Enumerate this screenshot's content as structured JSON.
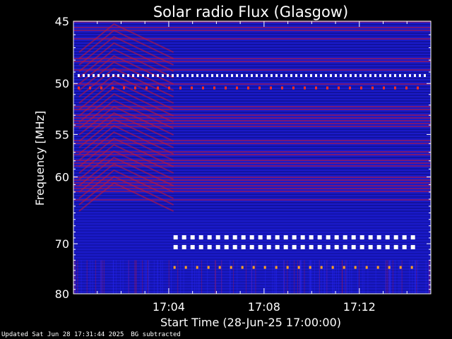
{
  "chart_data": {
    "type": "heatmap",
    "title": "Solar radio Flux (Glasgow)",
    "xlabel": "Start Time (28-Jun-25 17:00:00)",
    "ylabel": "Frequency [MHz]",
    "x_unit": "minutes after 17:00",
    "xlim": [
      0,
      15
    ],
    "ylim": [
      45,
      80
    ],
    "y_ticks": [
      {
        "value": 45,
        "label": "45"
      },
      {
        "value": 50,
        "label": "50"
      },
      {
        "value": 55,
        "label": "55"
      },
      {
        "value": 60,
        "label": "60"
      },
      {
        "value": 70,
        "label": "70"
      },
      {
        "value": 80,
        "label": "80"
      }
    ],
    "x_ticks": [
      {
        "value": 4,
        "label": "17:04"
      },
      {
        "value": 8,
        "label": "17:08"
      },
      {
        "value": 12,
        "label": "17:12"
      }
    ],
    "interference_bands_mhz": [
      49.3,
      50.4,
      68.9,
      70.6,
      74.4
    ],
    "colors": {
      "background": "#000000",
      "base": "#1a1ac8",
      "stripe_red": "#c01838",
      "stripe_blue": "#0c0c80",
      "interference": "#ffffff",
      "flare": "#ff3020",
      "hot": "#ffa020"
    }
  },
  "footer": {
    "updated": "Updated Sat Jun 28 17:31:44 2025",
    "note": "BG subtracted"
  }
}
